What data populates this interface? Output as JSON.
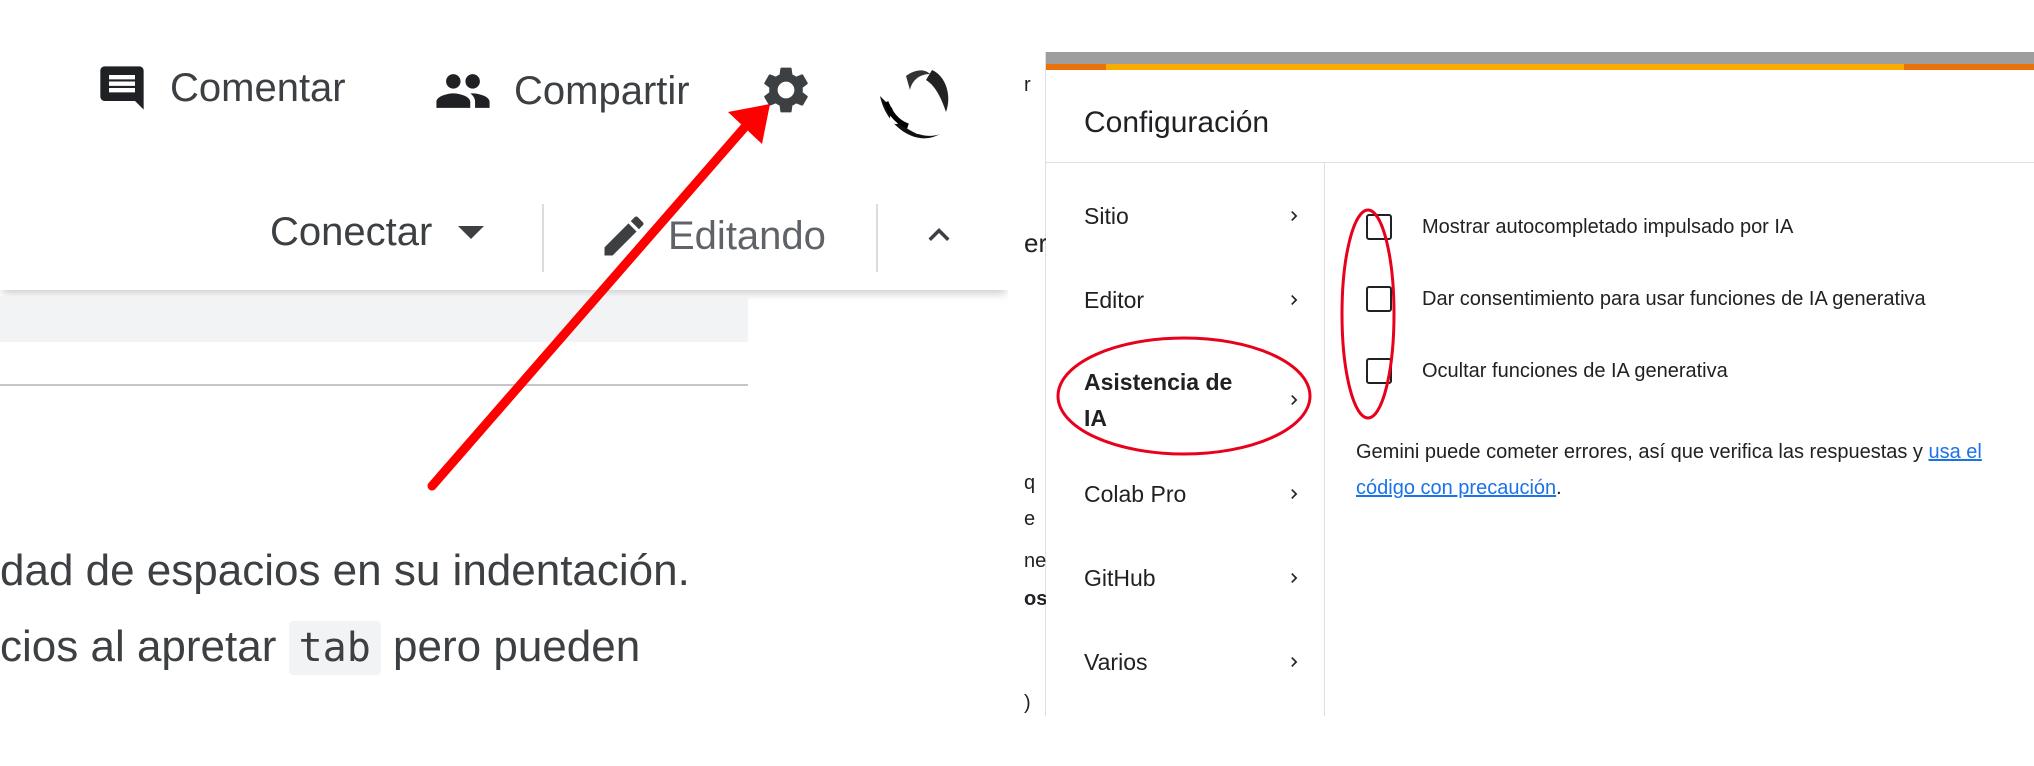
{
  "left_panel": {
    "header": {
      "comment_label": "Comentar",
      "share_label": "Compartir",
      "settings_icon": "gear-icon",
      "avatar_icon": "avatar"
    },
    "toolbar": {
      "connect_label": "Conectar",
      "editing_label": "Editando",
      "collapse_icon": "chevron-up-icon"
    },
    "content": {
      "line1": "dad de espacios en su indentación.",
      "line2_before": "cios al apretar ",
      "line2_code": "tab",
      "line2_after": " pero pueden"
    },
    "annotation": {
      "arrow_color": "#ff0000"
    }
  },
  "right_panel": {
    "background_peek": {
      "frag_r": "r",
      "frag_eri": "eri",
      "frag_q": "q",
      "frag_e": "e",
      "frag_ne": "ne",
      "frag_os": "os",
      "frag_paren": ")"
    },
    "dialog": {
      "title": "Configuración",
      "nav_items": [
        {
          "label": "Sitio"
        },
        {
          "label": "Editor"
        },
        {
          "label": "Asistencia de IA"
        },
        {
          "label": "Colab Pro"
        },
        {
          "label": "GitHub"
        },
        {
          "label": "Varios"
        }
      ],
      "active_nav": "Asistencia de IA",
      "options": [
        {
          "label": "Mostrar autocompletado impulsado por IA",
          "checked": false
        },
        {
          "label": "Dar consentimiento para usar funciones de IA generativa",
          "checked": false
        },
        {
          "label": "Ocultar funciones de IA generativa",
          "checked": false
        }
      ],
      "disclaimer_text": "Gemini puede cometer errores, así que verifica las respuestas y ",
      "disclaimer_link": "usa el código con precaución",
      "disclaimer_end": "."
    },
    "colors": {
      "accent_orange": "#f9ab00",
      "link_blue": "#1a73e8",
      "annotation_red": "#e8001c"
    }
  }
}
